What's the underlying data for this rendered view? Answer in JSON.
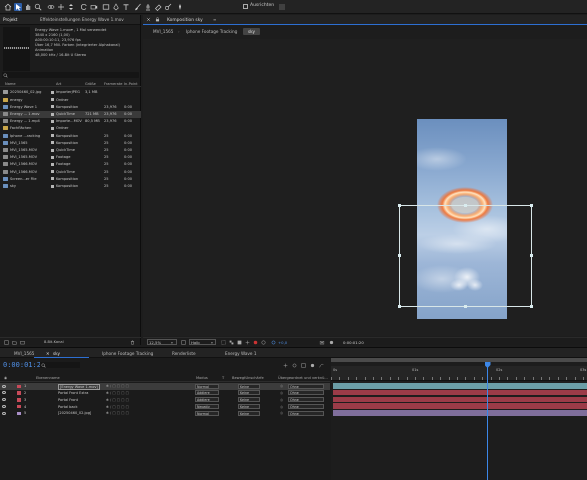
{
  "toolbar": {
    "tools": [
      "home-icon",
      "selection-tool-icon",
      "hand-tool-icon",
      "zoom-tool-icon",
      "orbit-camera-icon",
      "pan-camera-icon",
      "dolly-camera-icon",
      "rotate-tool-icon",
      "camera-tool-icon",
      "pan-behind-icon",
      "rectangle-mask-icon",
      "pen-tool-icon",
      "type-tool-icon",
      "brush-tool-icon",
      "clone-stamp-icon",
      "eraser-icon",
      "roto-brush-icon",
      "puppet-pin-icon"
    ],
    "align_label": "Ausrichten"
  },
  "project": {
    "tab_project": "Projekt",
    "tab_effects": "Effekteinstellungen Energy Wave 1.mov",
    "info_lines": [
      "Energy Wave 1.mov▾ , 1 Mal verwendet",
      "3840 x 2160 (1,00)",
      "Δ00:00:10:11, 23,976 fps",
      "Über 16,7 Mill. Farben (integrierter Alphakanal)",
      "Animation",
      "48,000 kHz / 16-Bit U Stereo"
    ],
    "columns": [
      "Name",
      "Art",
      "Größe",
      "Framerate",
      "In-Point"
    ],
    "items": [
      {
        "name": "20250460_02.jpg",
        "type": "ImporterJPEG",
        "size": "3,1 MB",
        "fps": "",
        "color": "#b7b7b7",
        "icon": "image"
      },
      {
        "name": "energy",
        "type": "Ordner",
        "size": "",
        "fps": "",
        "color": "#b7b7b7",
        "icon": "folder"
      },
      {
        "name": "Energy Wave 1",
        "type": "Komposition",
        "size": "",
        "fps": "23,976",
        "in": "0:00",
        "color": "#b7b7b7",
        "icon": "comp"
      },
      {
        "name": "Energy ... 1.mov",
        "type": "QuickTime",
        "size": "721 MB",
        "fps": "23,976",
        "in": "0:00",
        "color": "#b7b7b7",
        "icon": "footage",
        "selected": true
      },
      {
        "name": "Energy ... 1.mp4",
        "type": "Importe...MOV",
        "size": "80,5 MB",
        "fps": "23,976",
        "in": "0:00",
        "color": "#b7b7b7",
        "icon": "footage"
      },
      {
        "name": "Fachflächen",
        "type": "Ordner",
        "size": "",
        "fps": "",
        "color": "#b7b7b7",
        "icon": "folder"
      },
      {
        "name": "Iphone ...racking",
        "type": "Komposition",
        "size": "",
        "fps": "25",
        "in": "0:00",
        "color": "#b7b7b7",
        "icon": "comp"
      },
      {
        "name": "MVI_1565",
        "type": "Komposition",
        "size": "",
        "fps": "25",
        "in": "0:00",
        "color": "#b7b7b7",
        "icon": "comp"
      },
      {
        "name": "MVI_1565.MOV",
        "type": "QuickTime",
        "size": "",
        "fps": "25",
        "in": "0:00",
        "color": "#b7b7b7",
        "icon": "footage"
      },
      {
        "name": "MVI_1565.MOV",
        "type": "Footage",
        "size": "",
        "fps": "25",
        "in": "0:00",
        "color": "#b7b7b7",
        "icon": "footage"
      },
      {
        "name": "MVI_1566.MOV",
        "type": "Footage",
        "size": "",
        "fps": "25",
        "in": "0:00",
        "color": "#b7b7b7",
        "icon": "footage"
      },
      {
        "name": "MVI_1566.MOV",
        "type": "QuickTime",
        "size": "",
        "fps": "25",
        "in": "0:00",
        "color": "#b7b7b7",
        "icon": "footage"
      },
      {
        "name": "Screen...er File",
        "type": "Komposition",
        "size": "",
        "fps": "25",
        "in": "0:00",
        "color": "#b7b7b7",
        "icon": "comp"
      },
      {
        "name": "sky",
        "type": "Komposition",
        "size": "",
        "fps": "25",
        "in": "0:00",
        "color": "#b7b7b7",
        "icon": "comp"
      }
    ],
    "bit_depth": "8-Bit-Kanal"
  },
  "comp": {
    "title": "Komposition sky",
    "tabs": [
      "MVI_1565",
      "Iphone Footage Tracking",
      "sky"
    ],
    "active_tab": "sky",
    "zoom": "12,5%",
    "resolution": "Halb",
    "exposure": "+0,0",
    "timecode": "0:00:01:20"
  },
  "timeline": {
    "tabs": [
      "MVI_1565",
      "Iphone Footage Tracking",
      "Renderliste",
      "Energy Wave 1"
    ],
    "active_tab": "sky",
    "timecode": "0:00:01:20",
    "col_headers": [
      "Ebenenname",
      "Modus",
      "T",
      "BewegtUnschärfe",
      "Übergeordnet und verknü..."
    ],
    "layers": [
      {
        "num": "1",
        "name": "[Energy Wave 1.mov]",
        "mode": "Normal",
        "track": "Keine",
        "parent": "Ohne",
        "color": "#c74a59",
        "selected": true,
        "bar": "#6b9ea7"
      },
      {
        "num": "2",
        "name": "Portal Front Extra",
        "mode": "Addiere",
        "track": "Keine",
        "parent": "Ohne",
        "color": "#c74a59",
        "bar": "#9b3b48"
      },
      {
        "num": "3",
        "name": "Portal Front",
        "mode": "Addiere",
        "track": "Keine",
        "parent": "Ohne",
        "color": "#c74a59",
        "bar": "#9b3b48"
      },
      {
        "num": "4",
        "name": "Portal back",
        "mode": "Negativ",
        "track": "Keine",
        "parent": "Ohne",
        "color": "#c74a59",
        "bar": "#9b3b48"
      },
      {
        "num": "5",
        "name": "[20250460_02.jpg]",
        "mode": "Normal",
        "track": "Keine",
        "parent": "Ohne",
        "color": "#a98fc7",
        "bar": "#7f6e9b"
      }
    ],
    "ruler_labels": [
      "0s",
      "01s",
      "02s",
      "03s"
    ]
  }
}
